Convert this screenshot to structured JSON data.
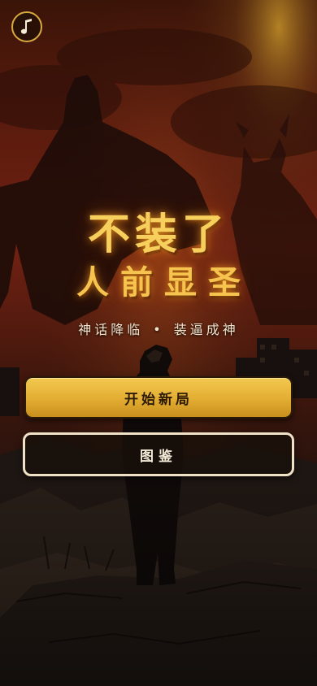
{
  "music_button": {
    "icon": "music-note-icon"
  },
  "title": {
    "line1": "不装了",
    "line2": "人前显圣"
  },
  "subtitle": {
    "left": "神话降临",
    "separator": "•",
    "right": "装逼成神"
  },
  "buttons": {
    "start_label": "开始新局",
    "gallery_label": "图鉴"
  },
  "colors": {
    "accent_gold": "#f3c94f",
    "title_gold": "#f7cf5c",
    "button_outline": "#efe2c6",
    "sky_red": "#7a2414"
  }
}
